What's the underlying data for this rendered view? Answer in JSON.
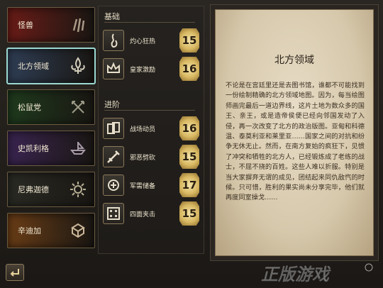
{
  "factions": [
    {
      "name": "怪兽",
      "bg": "#6b1c17",
      "emblem": "claw-icon"
    },
    {
      "name": "北方领域",
      "bg": "#2f3e55",
      "emblem": "fleur-icon",
      "active": true
    },
    {
      "name": "松鼠党",
      "bg": "#1f3a1d",
      "emblem": "arrows-icon"
    },
    {
      "name": "史凯利格",
      "bg": "#3a2450",
      "emblem": "ship-icon"
    },
    {
      "name": "尼弗迦德",
      "bg": "#2a2a24",
      "emblem": "sun-icon"
    },
    {
      "name": "辛迪加",
      "bg": "#6a3d16",
      "emblem": "coins-icon"
    }
  ],
  "sections": [
    {
      "title": "基础",
      "skills": [
        {
          "name": "灼心狂热",
          "level": "15",
          "icon": "flame-icon"
        },
        {
          "name": "皇家激励",
          "level": "16",
          "icon": "crown-icon"
        }
      ]
    },
    {
      "title": "进阶",
      "skills": [
        {
          "name": "战场动员",
          "level": "16",
          "icon": "cards-icon"
        },
        {
          "name": "邪恶劈砍",
          "level": "15",
          "icon": "sword-icon"
        },
        {
          "name": "军需储备",
          "level": "17",
          "icon": "plus-card-icon"
        },
        {
          "name": "四面夹击",
          "level": "15",
          "icon": "dice-icon"
        }
      ]
    }
  ],
  "detail": {
    "title": "北方领域",
    "text": "不论是在宫廷里还是去图书馆，谁都不可能找到一份绘制精确的北方领域地图。因为，每当绘图师画完最后一道边界线，这片土地为数众多的国王、亲王，或是造帝侯便已经向邻国发动了入侵，再一次改变了北方的政治版图。亚甸和科德温、泰莫利亚和莱里亚……国家之间的对抗和纷争无休无止。然而，在南方复始的疯狂下，见惯了冲突和牺牲的北方人，已经锻炼成了老练的战士，不屈不挠的百姓。这些人难以折服。特别是当大家摒弃无谓的成见，团结起来同仇敌忾的时候。只可惜，胜利的果实尚未分享完毕，他们就再度同室操戈……"
  },
  "watermark": "正版游戏"
}
